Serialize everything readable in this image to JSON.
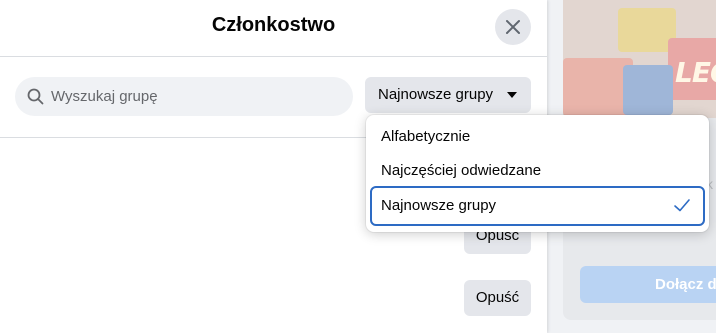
{
  "dialog": {
    "title": "Członkostwo",
    "search_placeholder": "Wyszukaj grupę",
    "sort_label": "Najnowsze grupy",
    "leave_labels": [
      "Opuść",
      "Opuść"
    ]
  },
  "dropdown": {
    "options": [
      "Alfabetycznie",
      "Najczęściej odwiedzane",
      "Najnowsze grupy"
    ],
    "selected": "Najnowsze grupy"
  },
  "background": {
    "logo_text": "LEG",
    "partial_letter": "k",
    "join_button_label": "Dołącz do"
  },
  "colors": {
    "accent": "#2d6bc4",
    "button_bg": "#e4e6eb",
    "join_bg": "#b9d3f3"
  }
}
